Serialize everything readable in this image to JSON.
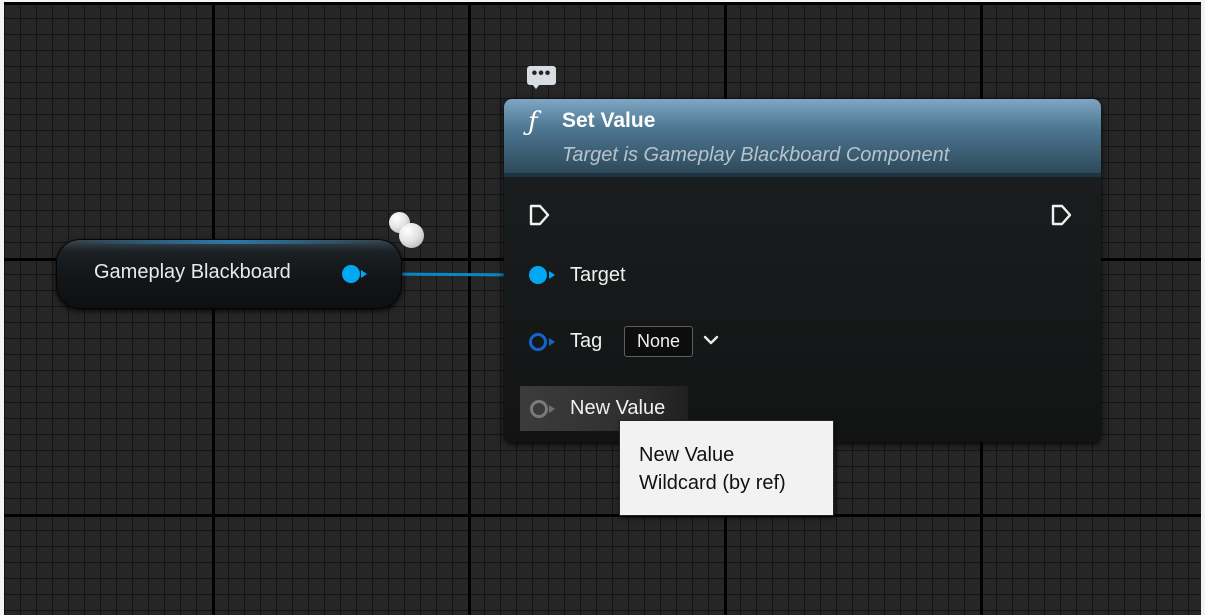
{
  "variable_node": {
    "label": "Gameplay Blackboard",
    "pin_color": "#00a8f4"
  },
  "function_node": {
    "icon": "function-icon",
    "title": "Set Value",
    "subtitle": "Target is Gameplay Blackboard Component",
    "header_color": "#4f7995",
    "pins": {
      "target_label": "Target",
      "tag_label": "Tag",
      "tag_value": "None",
      "new_value_label": "New Value"
    }
  },
  "tooltip": {
    "line1": "New Value",
    "line2": "Wildcard (by ref)"
  },
  "icons": {
    "comment": "comment-bubble-icon",
    "exec_in": "exec-in-pin-icon",
    "exec_out": "exec-out-pin-icon",
    "dropdown": "chevron-down-icon"
  }
}
